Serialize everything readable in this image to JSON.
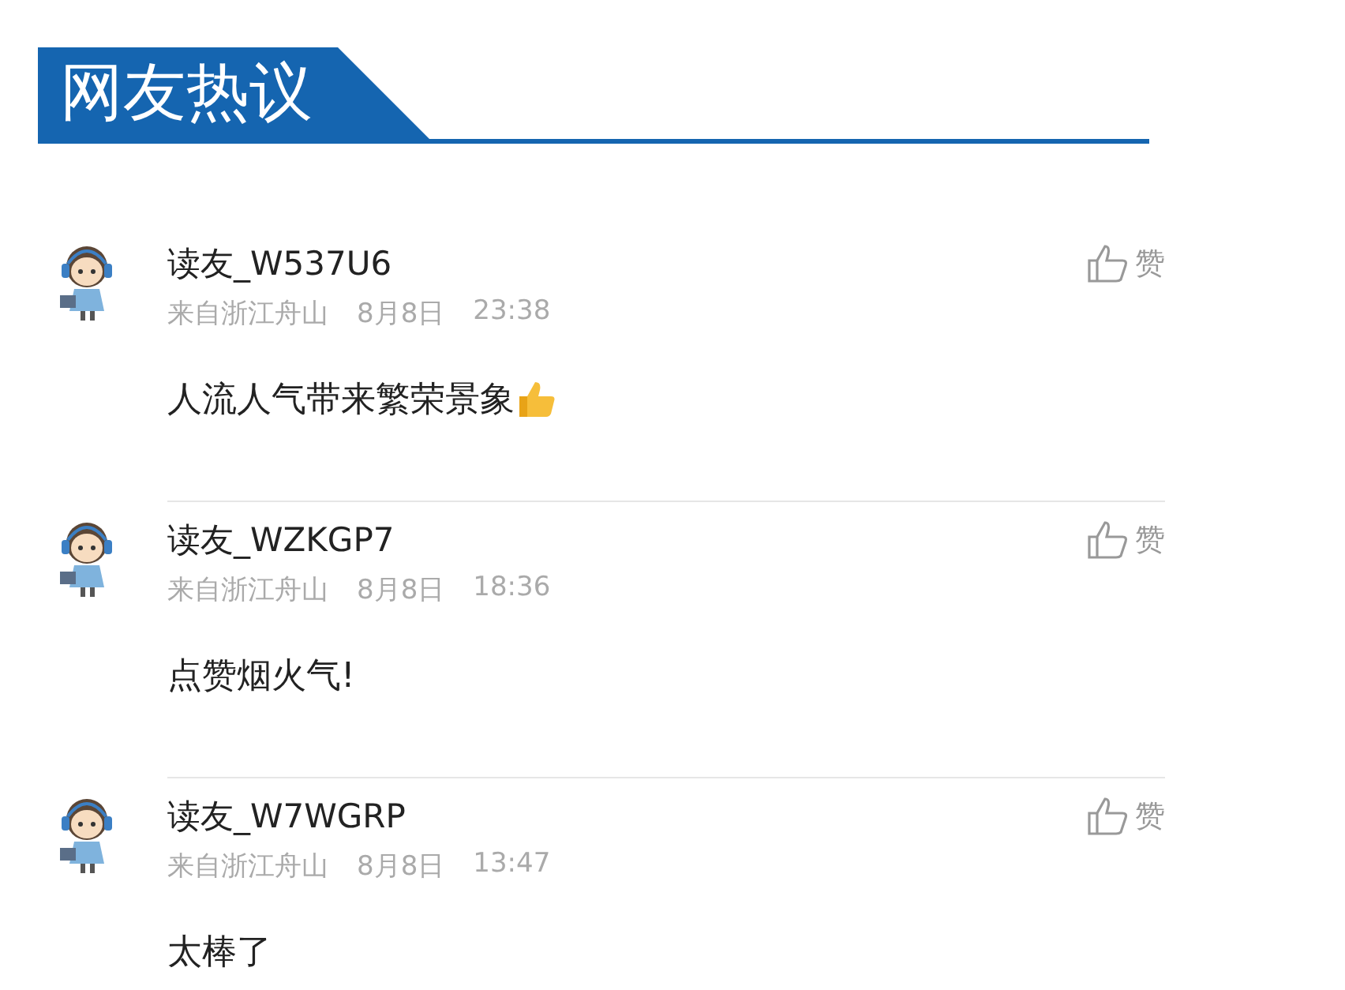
{
  "header": {
    "title": "网友热议"
  },
  "comments": [
    {
      "user": "读友_W537U6",
      "location": "来自浙江舟山",
      "date": "8月8日",
      "time": "23:38",
      "text": "人流人气带来繁荣景象",
      "emoji": true,
      "like_label": "赞"
    },
    {
      "user": "读友_WZKGP7",
      "location": "来自浙江舟山",
      "date": "8月8日",
      "time": "18:36",
      "text": "点赞烟火气!",
      "emoji": false,
      "like_label": "赞"
    },
    {
      "user": "读友_W7WGRP",
      "location": "来自浙江舟山",
      "date": "8月8日",
      "time": "13:47",
      "text": "太棒了",
      "emoji": false,
      "like_label": "赞"
    }
  ]
}
